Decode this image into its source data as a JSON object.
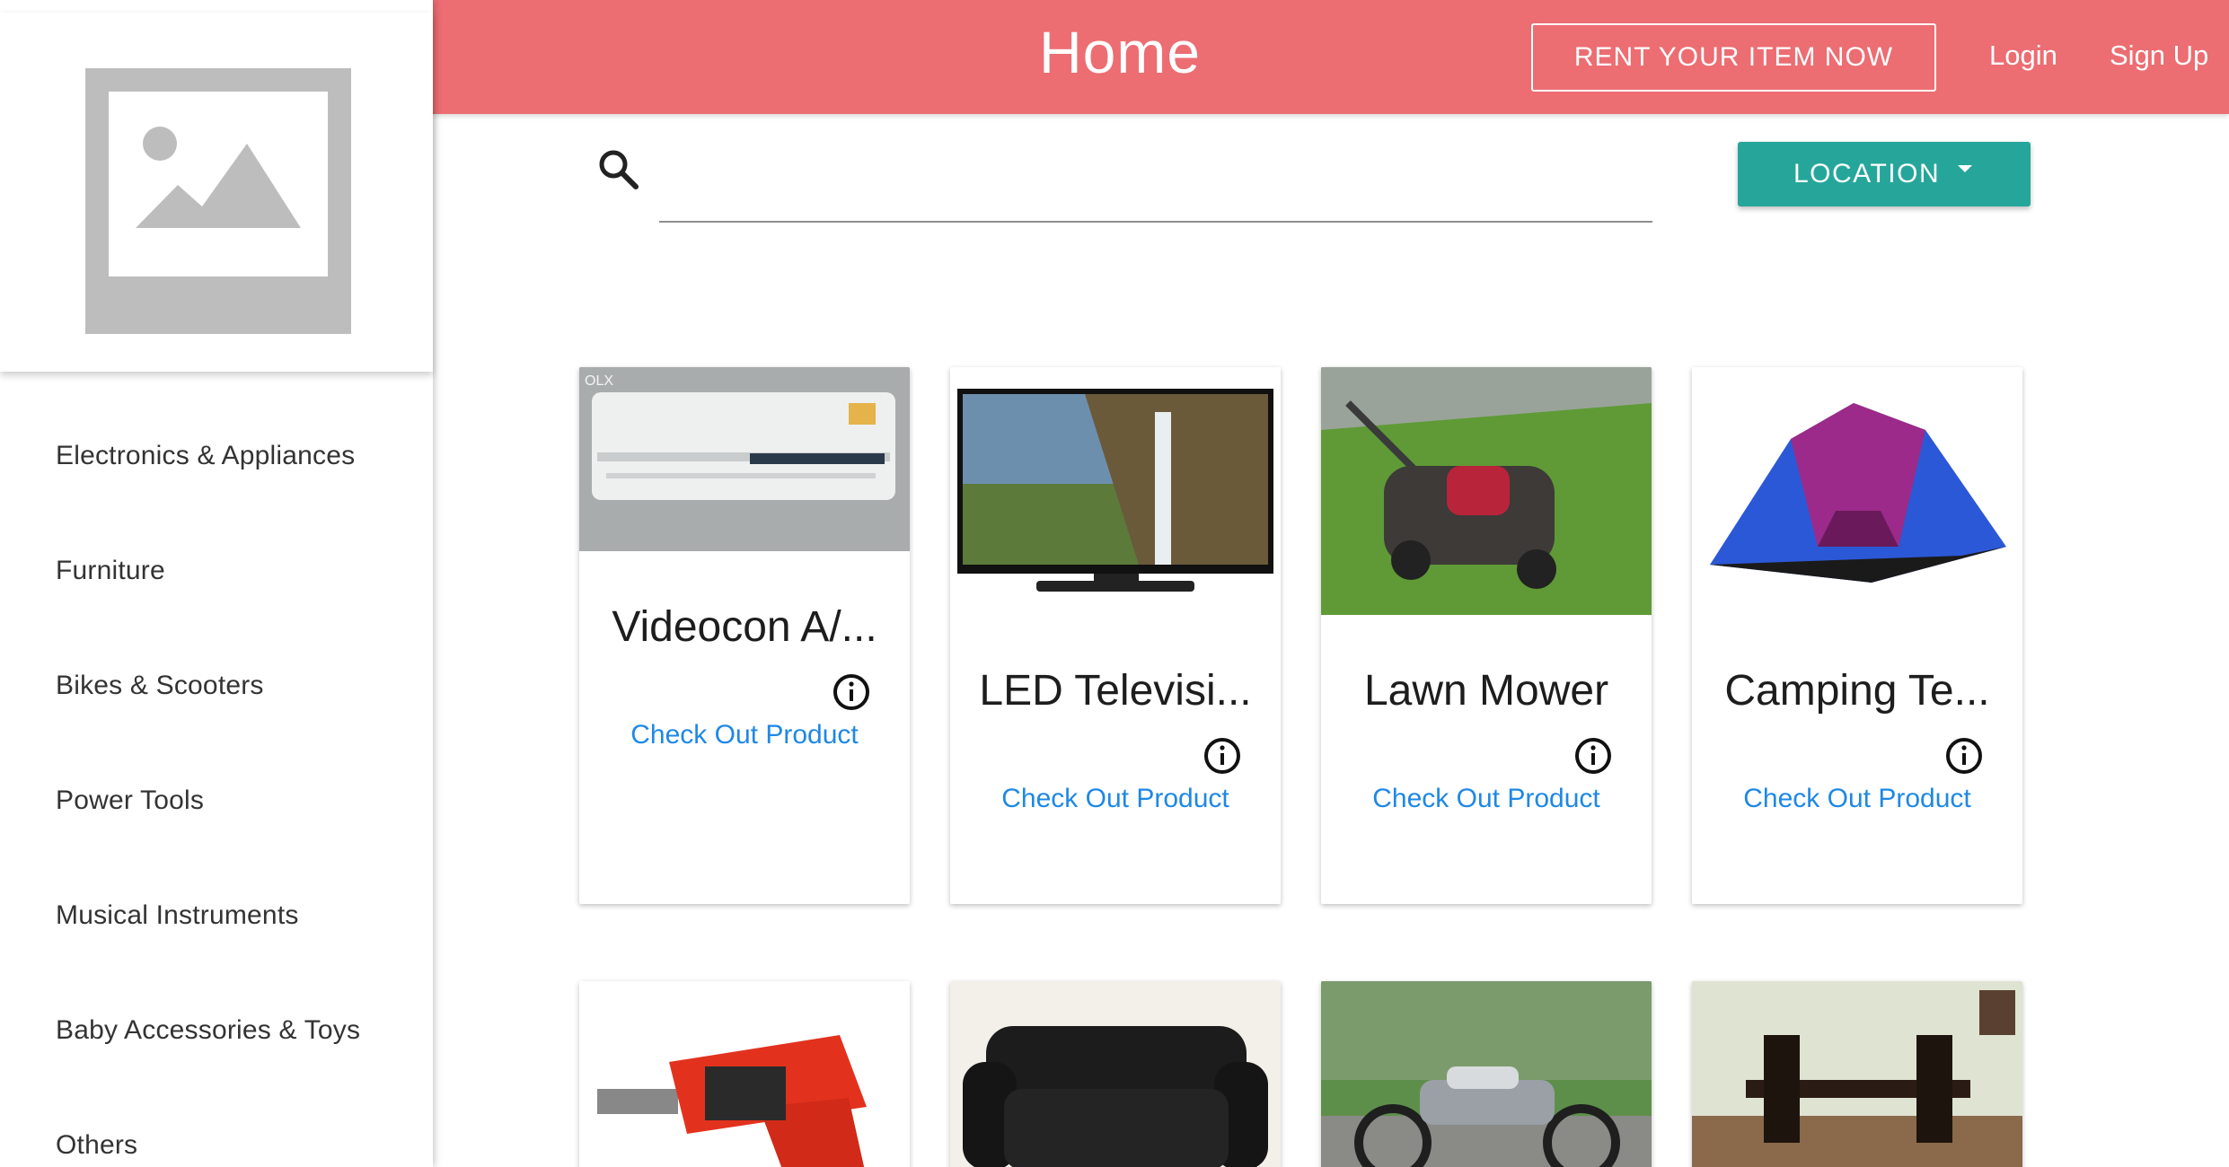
{
  "header": {
    "title": "Home",
    "rent_label": "RENT YOUR ITEM NOW",
    "login_label": "Login",
    "signup_label": "Sign Up",
    "accent_color": "#ec6d72"
  },
  "search": {
    "icon": "search-icon",
    "placeholder": "",
    "value": "",
    "location_label": "LOCATION",
    "location_color": "#26a69a"
  },
  "sidebar": {
    "logo_icon": "image-placeholder-icon",
    "items": [
      {
        "label": "Electronics & Appliances"
      },
      {
        "label": "Furniture"
      },
      {
        "label": "Bikes & Scooters"
      },
      {
        "label": "Power Tools"
      },
      {
        "label": "Musical Instruments"
      },
      {
        "label": "Baby Accessories & Toys"
      },
      {
        "label": "Others"
      }
    ]
  },
  "products": [
    {
      "title": "Videocon A/...",
      "link": "Check Out Product",
      "image": "air-conditioner-photo"
    },
    {
      "title": "LED Televisi...",
      "link": "Check Out Product",
      "image": "led-television-photo"
    },
    {
      "title": "Lawn Mower",
      "link": "Check Out Product",
      "image": "lawn-mower-photo"
    },
    {
      "title": "Camping Te...",
      "link": "Check Out Product",
      "image": "camping-tent-photo"
    },
    {
      "title": "",
      "link": "",
      "image": "power-drill-photo"
    },
    {
      "title": "",
      "link": "",
      "image": "leather-sofa-photo"
    },
    {
      "title": "",
      "link": "",
      "image": "motorcycle-photo"
    },
    {
      "title": "",
      "link": "",
      "image": "dining-table-photo"
    }
  ],
  "link_color": "#1e88e5"
}
